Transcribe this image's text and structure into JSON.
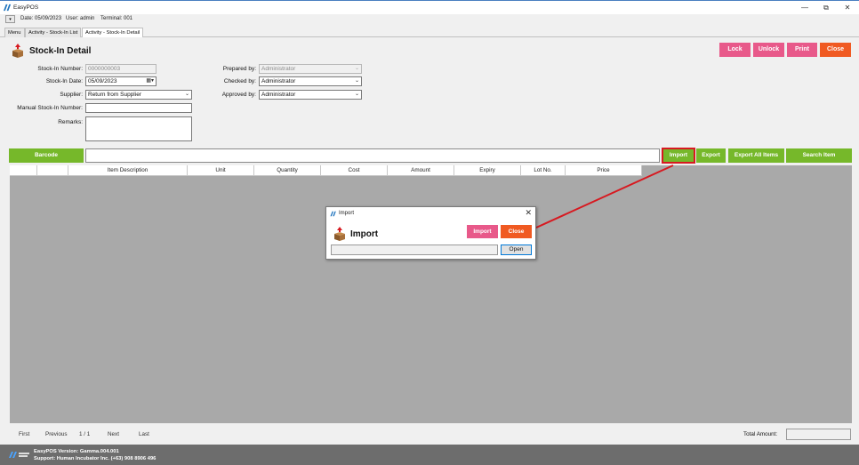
{
  "window": {
    "title": "EasyPOS",
    "controls": [
      "—",
      "⧉",
      "✕"
    ]
  },
  "info": {
    "date": "Date: 05/09/2023",
    "user": "User: admin",
    "terminal": "Terminal: 001"
  },
  "tabs": [
    {
      "label": "Menu"
    },
    {
      "label": "Activity - Stock-In List"
    },
    {
      "label": "Activity - Stock-In Detail"
    }
  ],
  "header": {
    "title": "Stock-In Detail",
    "buttons": {
      "lock": "Lock",
      "unlock": "Unlock",
      "print": "Print",
      "close": "Close"
    }
  },
  "form": {
    "stock_in_number_label": "Stock-In Number:",
    "stock_in_number": "0000000003",
    "stock_in_date_label": "Stock-In Date:",
    "stock_in_date": "05/09/2023",
    "supplier_label": "Supplier:",
    "supplier": "Return from Supplier",
    "manual_number_label": "Manual Stock-In Number:",
    "manual_number": "",
    "remarks_label": "Remarks:",
    "remarks": "",
    "prepared_by_label": "Prepared by:",
    "prepared_by": "Administrator",
    "checked_by_label": "Checked by:",
    "checked_by": "Administrator",
    "approved_by_label": "Approved by:",
    "approved_by": "Administrator"
  },
  "toolbar": {
    "barcode": "Barcode",
    "import": "Import",
    "export": "Export",
    "export_all": "Export All Items",
    "search_item": "Search Item"
  },
  "grid": {
    "columns": [
      "",
      "",
      "Item Description",
      "Unit",
      "Quantity",
      "Cost",
      "Amount",
      "Expiry",
      "Lot No.",
      "Price"
    ]
  },
  "dialog": {
    "title": "Import",
    "heading": "Import",
    "import_button": "Import",
    "close_button": "Close",
    "open_button": "Open",
    "path": ""
  },
  "pager": {
    "first": "First",
    "previous": "Previous",
    "page": "1 / 1",
    "next": "Next",
    "last": "Last",
    "total_amount_label": "Total Amount:",
    "total_amount": ""
  },
  "status": {
    "version": "EasyPOS Version: Gamma.004.001",
    "support": "Support: Human Incubator Inc. (+63) 908 8906 496"
  },
  "colors": {
    "pink": "#e8598a",
    "orange": "#f05a22",
    "green": "#76b82a",
    "annotation_red": "#d71920",
    "grid_bg": "#a9a9a9",
    "status_bg": "#6d6d6d"
  }
}
